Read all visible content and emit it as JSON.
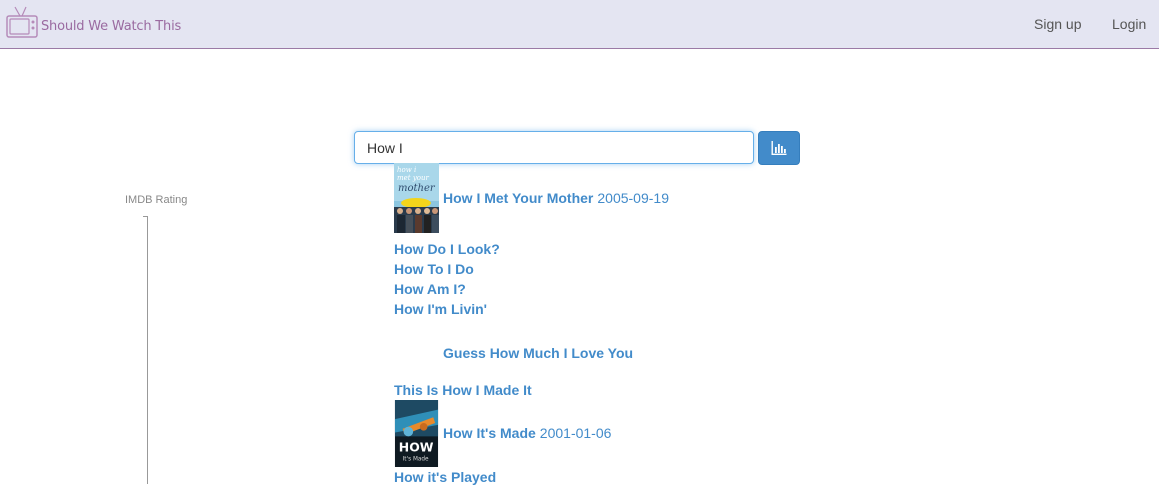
{
  "navbar": {
    "brand_name": "Should We Watch This",
    "brand_icon": "tv-icon",
    "signup_label": "Sign up",
    "login_label": "Login"
  },
  "search": {
    "value": "How I",
    "button_icon": "bar-chart-icon"
  },
  "sidebar": {
    "rating_label": "IMDB Rating"
  },
  "results": [
    {
      "title": "How I Met Your Mother",
      "date": "2005-09-19",
      "poster": "how-i-met-your-mother-poster"
    },
    {
      "title": "How Do I Look?",
      "date": "",
      "poster": ""
    },
    {
      "title": "How To I Do",
      "date": "",
      "poster": ""
    },
    {
      "title": "How Am I?",
      "date": "",
      "poster": ""
    },
    {
      "title": "How I'm Livin'",
      "date": "",
      "poster": ""
    },
    {
      "title": "Guess How Much I Love You",
      "date": "",
      "poster": "blank"
    },
    {
      "title": "This Is How I Made It",
      "date": "",
      "poster": ""
    },
    {
      "title": "How It's Made",
      "date": "2001-01-06",
      "poster": "how-its-made-poster"
    },
    {
      "title": "How it's Played",
      "date": "",
      "poster": ""
    }
  ],
  "colors": {
    "navbar_bg": "#e4e5f2",
    "brand": "#9a6aa0",
    "link": "#428bca",
    "button": "#428bca"
  }
}
